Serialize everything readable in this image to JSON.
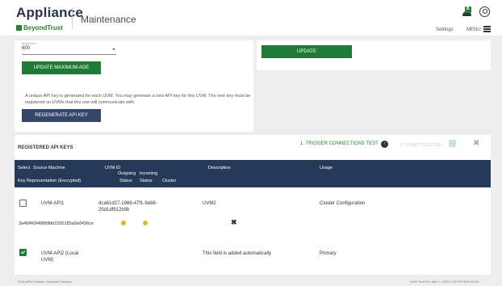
{
  "header": {
    "app_title": "Appliance",
    "brand": "BeyondTrust",
    "page_name": "Maintenance",
    "settings_label": "Settings",
    "menu_label": "MENU",
    "user_badge_letter": "B"
  },
  "max_age": {
    "label": "Maximum...",
    "value": "600",
    "button_label": "UPDATE MAXIMUM AGE"
  },
  "api_key_info": {
    "text": "A unique API key is generated for each UVM. You may generate a new API key for this UVM. The new key must be registered on UVMs that this one will communicate with.",
    "regenerate_label": "REGENERATE API KEY"
  },
  "right_panel": {
    "update_label": "UPDATE"
  },
  "registered_keys": {
    "title": "REGISTERED API KEYS",
    "trigger_label": "1. TRIGGER CONNECTIONS TEST",
    "start_cluster_label": "2. START CLUSTER",
    "columns": {
      "select": "Select",
      "source_machine": "Source Machine",
      "uvm_id": "UVM ID",
      "outgoing": "Outgoing",
      "incoming": "Incoming",
      "description": "Description",
      "usage": "Usage",
      "key_representation": "Key Representation (Encrypted)",
      "status_out": "Status",
      "status_in": "Status",
      "cluster": "Cluster"
    },
    "rows": [
      {
        "source_machine": "UVM-API1",
        "uvm_id": "dca61d27-1988-47f1-9e88-25d1df812b9b",
        "description": "UVM2",
        "usage": "Cluster Configuration",
        "key": "3a46f469498fdfdd1550185a0e8436ce",
        "selected": false
      },
      {
        "source_machine": "UVM-API2 (Local UVM)",
        "uvm_id": "",
        "description": "This field is added automatically",
        "usage": "Primary",
        "selected": true
      }
    ]
  },
  "footer": {
    "left": "UVM-API2 Version: Unknown Version",
    "right": "UVM Time:Fri, Mar 1, 2019 1:40 PM GMT-04:00"
  },
  "colors": {
    "brand_green": "#1f7a35",
    "navy": "#253a59",
    "status_yellow": "#e0b81c"
  }
}
